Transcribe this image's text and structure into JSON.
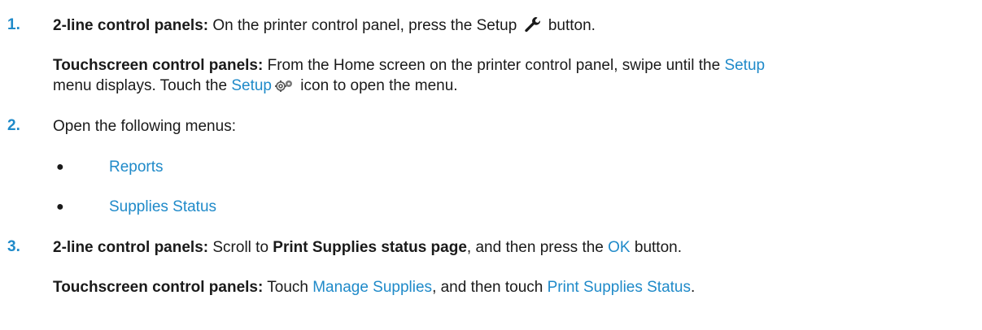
{
  "steps": [
    {
      "number": "1.",
      "p1": {
        "label": "2-line control panels:",
        "text_before_icon": " On the printer control panel, press the Setup ",
        "icon": "wrench-icon",
        "text_after_icon": " button."
      },
      "p2": {
        "label": "Touchscreen control panels:",
        "text1": " From the Home screen on the printer control panel, swipe until the ",
        "link1": "Setup",
        "line2_text_start": "menu displays. Touch the ",
        "link2": "Setup",
        "icon": "setup-gears-icon",
        "text_end": " icon to open the menu."
      }
    },
    {
      "number": "2.",
      "intro": "Open the following menus:",
      "menu_items": [
        "Reports",
        "Supplies Status"
      ]
    },
    {
      "number": "3.",
      "p1": {
        "label": "2-line control panels:",
        "text1": " Scroll to ",
        "bold_item": "Print Supplies status page",
        "text2": ", and then press the ",
        "link": "OK",
        "text3": " button."
      },
      "p2": {
        "label": "Touchscreen control panels:",
        "text1": " Touch ",
        "link1": "Manage Supplies",
        "text2": ", and then touch ",
        "link2": "Print Supplies Status",
        "text3": "."
      }
    }
  ],
  "colors": {
    "accent": "#1f8ac9",
    "text": "#1a1a1a"
  }
}
